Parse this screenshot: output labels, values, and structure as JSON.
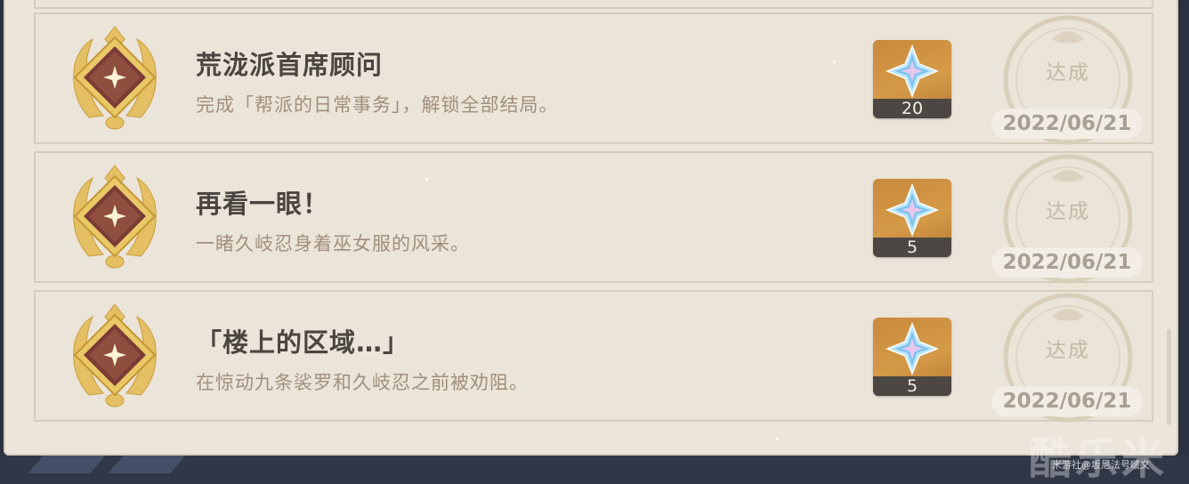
{
  "achievements": [
    {
      "title": "荒泷派首席顾问",
      "description": "完成「帮派的日常事务」，解锁全部结局。",
      "reward_count": "20",
      "status": "达成",
      "date": "2022/06/21"
    },
    {
      "title": "再看一眼！",
      "description": "一睹久岐忍身着巫女服的风采。",
      "reward_count": "5",
      "status": "达成",
      "date": "2022/06/21"
    },
    {
      "title": "「楼上的区域…」",
      "description": "在惊动九条裟罗和久岐忍之前被劝阻。",
      "reward_count": "5",
      "status": "达成",
      "date": "2022/06/21"
    }
  ],
  "icons": {
    "medal": "gold-laurel-medal-icon",
    "reward": "primogem-icon"
  },
  "colors": {
    "panel_bg": "#ece5da",
    "title_text": "#4a4540",
    "desc_text": "#a18e7c",
    "reward_bg": "#d59a48",
    "medal_gold": "#e8c56c"
  },
  "watermark": {
    "logo": "酷乐米",
    "caption": "米游社@坂尼法号啵文"
  }
}
